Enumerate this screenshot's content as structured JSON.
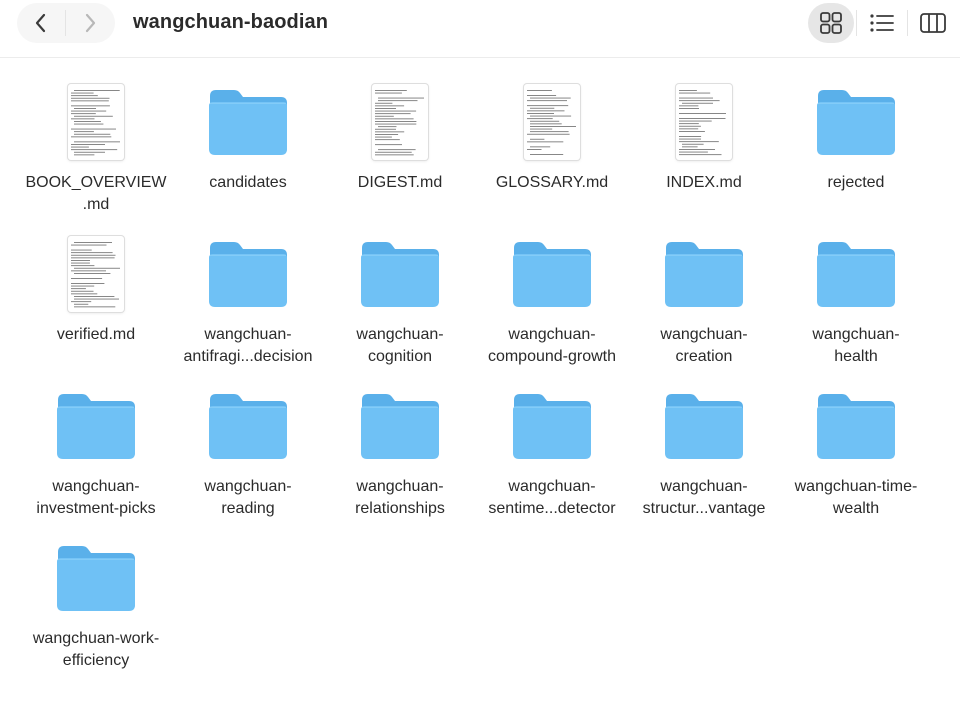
{
  "window": {
    "title": "wangchuan-baodian"
  },
  "toolbar": {
    "back_icon": "chevron-left-icon",
    "forward_icon": "chevron-right-icon",
    "views": [
      "icon-view-icon",
      "list-view-icon",
      "column-view-icon"
    ],
    "active_view": "icon-view-icon"
  },
  "colors": {
    "folder_back": "#5ab0ea",
    "folder_front": "#6fc1f5",
    "title": "#2b2b2b"
  },
  "items": [
    {
      "label": "BOOK_OVERVIEW\n.md",
      "kind": "document"
    },
    {
      "label": "candidates",
      "kind": "folder"
    },
    {
      "label": "DIGEST.md",
      "kind": "document"
    },
    {
      "label": "GLOSSARY.md",
      "kind": "document"
    },
    {
      "label": "INDEX.md",
      "kind": "document"
    },
    {
      "label": "rejected",
      "kind": "folder"
    },
    {
      "label": "verified.md",
      "kind": "document"
    },
    {
      "label": "wangchuan-\nantifragi...decision",
      "kind": "folder"
    },
    {
      "label": "wangchuan-\ncognition",
      "kind": "folder"
    },
    {
      "label": "wangchuan-\ncompound-growth",
      "kind": "folder"
    },
    {
      "label": "wangchuan-\ncreation",
      "kind": "folder"
    },
    {
      "label": "wangchuan-\nhealth",
      "kind": "folder"
    },
    {
      "label": "wangchuan-\ninvestment-picks",
      "kind": "folder"
    },
    {
      "label": "wangchuan-\nreading",
      "kind": "folder"
    },
    {
      "label": "wangchuan-\nrelationships",
      "kind": "folder"
    },
    {
      "label": "wangchuan-\nsentime...detector",
      "kind": "folder"
    },
    {
      "label": "wangchuan-\nstructur...vantage",
      "kind": "folder"
    },
    {
      "label": "wangchuan-time-\nwealth",
      "kind": "folder"
    },
    {
      "label": "wangchuan-work-\nefficiency",
      "kind": "folder"
    }
  ]
}
